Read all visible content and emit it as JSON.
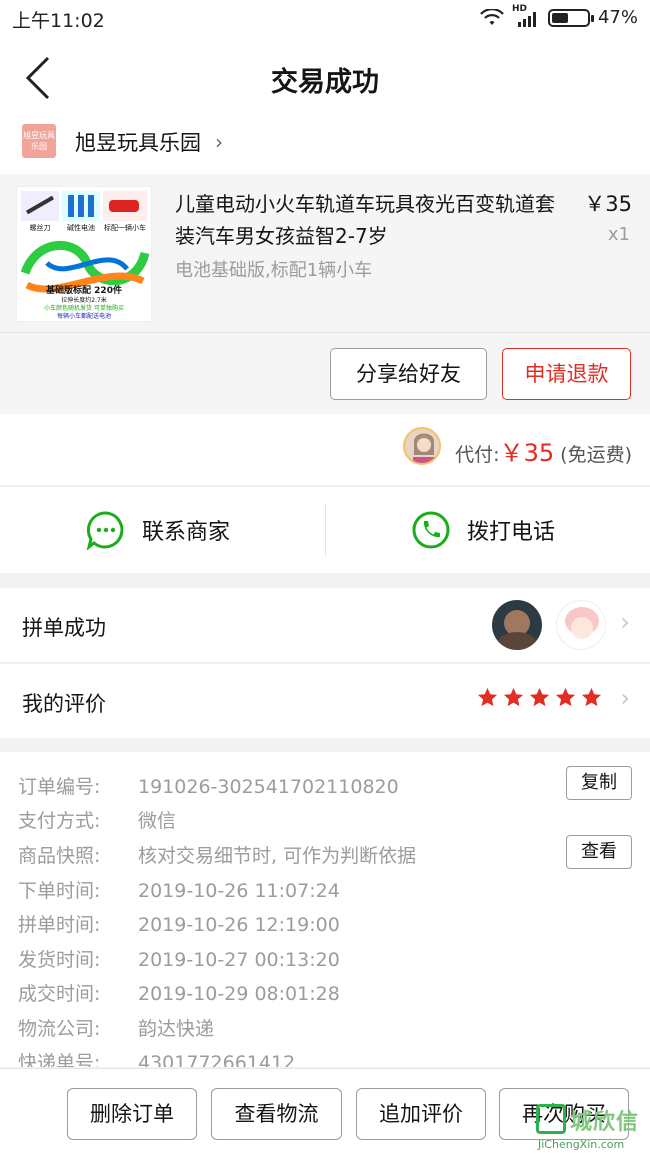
{
  "status_bar": {
    "time": "上午11:02",
    "network": "HD",
    "battery_percent": "47%",
    "battery_level": 0.47
  },
  "nav": {
    "title": "交易成功"
  },
  "shop": {
    "logo_text": "旭昱玩具乐园",
    "name": "旭昱玩具乐园"
  },
  "goods": {
    "title": "儿童电动小火车轨道车玩具夜光百变轨道套装汽车男女孩益智2-7岁",
    "spec": "电池基础版,标配1辆小车",
    "price": "￥35",
    "qty": "x1",
    "thumb": {
      "tags": [
        "螺丝刀",
        "碱性电池",
        "标配一辆小车"
      ],
      "caption": "基础版标配 220件",
      "sub1": "拉伸长度约2.7米",
      "sub2": "小车颜色随机发货 可单独购买",
      "sub3": "每辆小车都配送电池"
    },
    "share_label": "分享给好友",
    "refund_label": "申请退款"
  },
  "payment": {
    "prefix": "代付:",
    "amount": "￥35",
    "note": "(免运费)"
  },
  "contact": {
    "merchant_label": "联系商家",
    "call_label": "拨打电话"
  },
  "group": {
    "label": "拼单成功"
  },
  "review": {
    "label": "我的评价",
    "stars": 5
  },
  "details": {
    "order_no": {
      "label": "订单编号:",
      "value": "191026-302541702110820",
      "button": "复制"
    },
    "pay_method": {
      "label": "支付方式:",
      "value": "微信"
    },
    "snapshot": {
      "label": "商品快照:",
      "value": "核对交易细节时, 可作为判断依据",
      "button": "查看"
    },
    "order_time": {
      "label": "下单时间:",
      "value": "2019-10-26 11:07:24"
    },
    "group_time": {
      "label": "拼单时间:",
      "value": "2019-10-26 12:19:00"
    },
    "ship_time": {
      "label": "发货时间:",
      "value": "2019-10-27 00:13:20"
    },
    "deal_time": {
      "label": "成交时间:",
      "value": "2019-10-29 08:01:28"
    },
    "logistics": {
      "label": "物流公司:",
      "value": "韵达快递"
    },
    "tracking": {
      "label": "快递单号:",
      "value": "4301772661412"
    }
  },
  "actions": {
    "delete": "删除订单",
    "logistics": "查看物流",
    "add_review": "追加评价",
    "rebuy": "再次购买"
  },
  "watermark": {
    "name": "城欣信",
    "url": "JiChengXin.com"
  },
  "colors": {
    "accent_red": "#e02e24",
    "wechat_green": "#1aad19",
    "star_red": "#e02e24"
  }
}
